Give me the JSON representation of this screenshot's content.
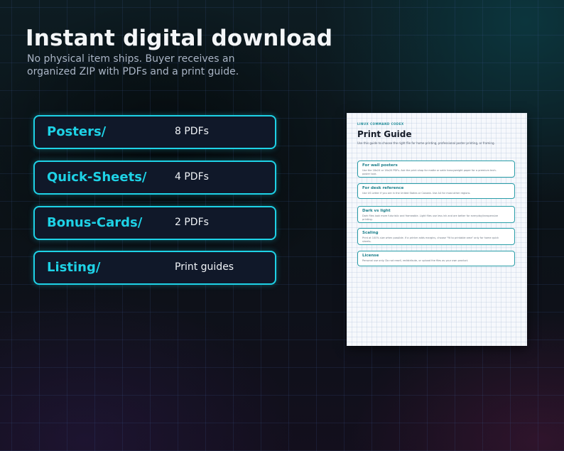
{
  "header": {
    "title": "Instant digital download",
    "subtitle": "No physical item ships. Buyer receives an organized ZIP with PDFs and a print guide."
  },
  "folders": [
    {
      "name": "Posters/",
      "count": "8 PDFs"
    },
    {
      "name": "Quick-Sheets/",
      "count": "4 PDFs"
    },
    {
      "name": "Bonus-Cards/",
      "count": "2 PDFs"
    },
    {
      "name": "Listing/",
      "count": "Print guides"
    }
  ],
  "guide": {
    "brand": "LINUX COMMAND CODEX",
    "title": "Print Guide",
    "intro": "Use this guide to choose the right file for home printing, professional poster printing, or framing.",
    "sections": [
      {
        "title": "For wall posters",
        "body": "Use the 18x24 or 16x20 PDFs. Ask the print shop for matte or satin heavyweight paper for a premium tech-poster look."
      },
      {
        "title": "For desk reference",
        "body": "Use US Letter if you are in the United States or Canada. Use A4 for most other regions."
      },
      {
        "title": "Dark vs light",
        "body": "Dark files look more futuristic and frameable. Light files use less ink and are better for everyday/inexpensive printing."
      },
      {
        "title": "Scaling",
        "body": "Print at 100% size when possible. If a printer adds margins, choose \"fit to printable area\" only for home quick sheets."
      },
      {
        "title": "License",
        "body": "Personal use only. Do not resell, redistribute, or upload the files as your own product."
      }
    ]
  },
  "colors": {
    "accent": "#1ed2e6",
    "folder_bg": "#101829",
    "title": "#f4f6f8",
    "subtitle": "#aab5c6"
  }
}
